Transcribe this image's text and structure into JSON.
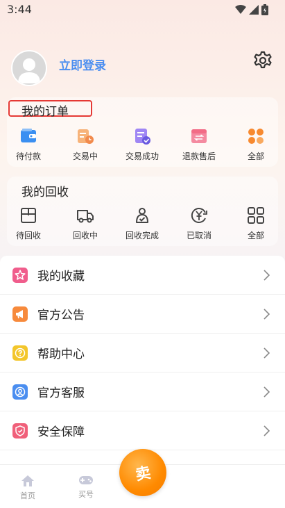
{
  "status": {
    "time": "3:44"
  },
  "profile": {
    "login_label": "立即登录"
  },
  "orders": {
    "title": "我的订单",
    "items": [
      {
        "label": "待付款",
        "icon": "wallet-icon",
        "color": "#3b8ff1"
      },
      {
        "label": "交易中",
        "icon": "clock-cart-icon",
        "color": "#f5a25c"
      },
      {
        "label": "交易成功",
        "icon": "doc-check-icon",
        "color": "#8b6cf0"
      },
      {
        "label": "退款售后",
        "icon": "refund-icon",
        "color": "#f26c86"
      },
      {
        "label": "全部",
        "icon": "grid-icon",
        "color": "#f7892f"
      }
    ]
  },
  "recycle": {
    "title": "我的回收",
    "items": [
      {
        "label": "待回收",
        "icon": "box-icon"
      },
      {
        "label": "回收中",
        "icon": "truck-icon"
      },
      {
        "label": "回收完成",
        "icon": "recycle-done-icon"
      },
      {
        "label": "已取消",
        "icon": "yen-cancel-icon"
      },
      {
        "label": "全部",
        "icon": "grid-outline-icon"
      }
    ]
  },
  "menu": [
    {
      "label": "我的收藏",
      "icon": "star-icon",
      "color": "#f05d8c"
    },
    {
      "label": "官方公告",
      "icon": "megaphone-icon",
      "color": "#f78a3c"
    },
    {
      "label": "帮助中心",
      "icon": "help-icon",
      "color": "#f3c62b"
    },
    {
      "label": "官方客服",
      "icon": "service-icon",
      "color": "#4a8ef0"
    },
    {
      "label": "安全保障",
      "icon": "shield-icon",
      "color": "#f0607a"
    }
  ],
  "tabbar": {
    "home": "首页",
    "buy": "买号",
    "sell": "卖"
  }
}
